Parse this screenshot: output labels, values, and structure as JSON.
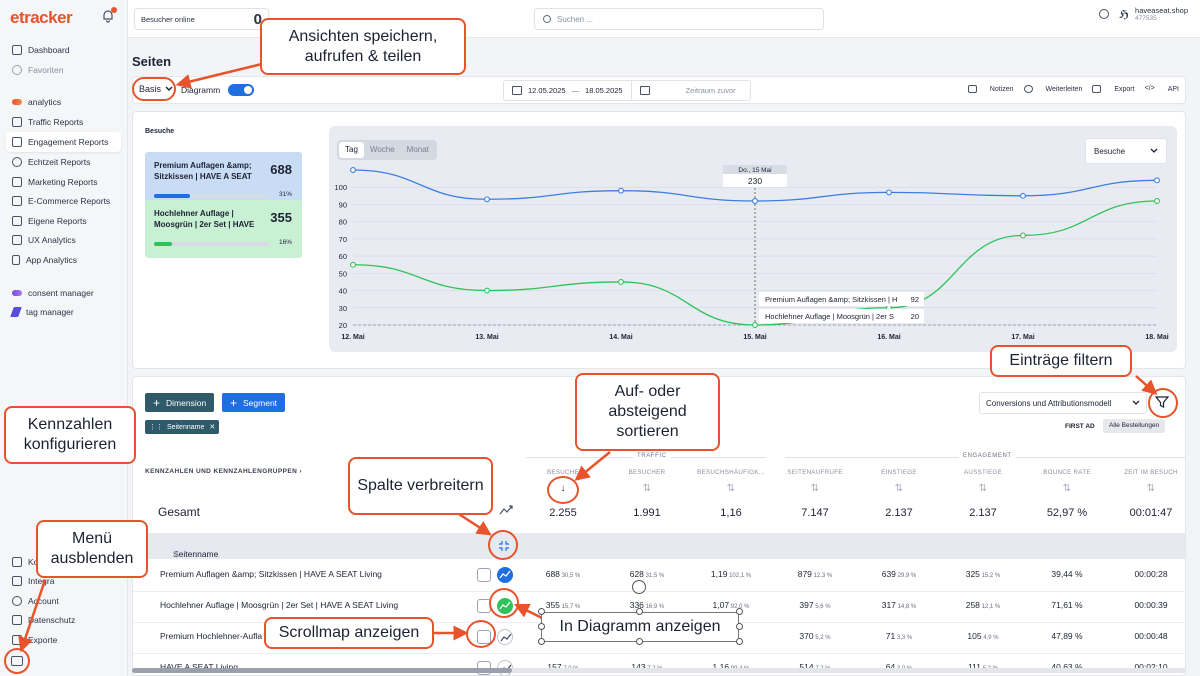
{
  "app": {
    "logo": "etracker"
  },
  "sidebar": {
    "items": [
      {
        "label": "Dashboard",
        "top": 44
      },
      {
        "label": "Favoriten",
        "muted": true
      },
      {
        "label": "analytics"
      },
      {
        "label": "Traffic Reports"
      },
      {
        "label": "Engagement Reports",
        "active": true
      },
      {
        "label": "Echtzeit Reports"
      },
      {
        "label": "Marketing Reports"
      },
      {
        "label": "E-Commerce Reports"
      },
      {
        "label": "Eigene Reports"
      },
      {
        "label": "UX Analytics"
      },
      {
        "label": "App Analytics"
      },
      {
        "label": "consent manager"
      },
      {
        "label": "tag manager"
      }
    ],
    "bottom": [
      "Ko",
      "Integra",
      "Account",
      "Datenschutz",
      "Exporte"
    ]
  },
  "topbar": {
    "visitors_label": "Besucher online",
    "visitors_count": "0",
    "search_placeholder": "Suchen ...",
    "account_name": "haveaseat.shop",
    "account_id": "477535"
  },
  "page": {
    "title": "Seiten"
  },
  "toolbar": {
    "view": "Basis",
    "diagram_label": "Diagramm",
    "date_from": "12.05.2025",
    "date_sep": "—",
    "date_to": "18.05.2025",
    "compare_placeholder": "Zeitraum zuvor",
    "actions": {
      "notes": "Notizen",
      "forward": "Weiterleiten",
      "export": "Export",
      "api": "API"
    }
  },
  "kpis": {
    "section_label": "Besuche",
    "cards": [
      {
        "name": "Premium Auflagen &amp; Sitzkissen | HAVE A SEAT",
        "value": "688",
        "pct": "31%",
        "share": 0.31
      },
      {
        "name": "Hochlehner Auflage | Moosgrün | 2er Set | HAVE",
        "value": "355",
        "pct": "16%",
        "share": 0.16
      }
    ]
  },
  "chart_controls": {
    "tabs": [
      "Tag",
      "Woche",
      "Monat"
    ],
    "active_tab": "Tag",
    "metric": "Besuche"
  },
  "chart_data": {
    "type": "line",
    "categories": [
      "12. Mai",
      "13. Mai",
      "14. Mai",
      "15. Mai",
      "16. Mai",
      "17. Mai",
      "18. Mai"
    ],
    "series": [
      {
        "name": "Premium Auflagen &amp; Sitzkissen | H",
        "color": "#3d7fe0",
        "values": [
          110,
          93,
          98,
          92,
          97,
          95,
          104
        ]
      },
      {
        "name": "Hochlehner Auflage | Moosgrün | 2er S",
        "color": "#2ec25a",
        "values": [
          55,
          40,
          45,
          20,
          30,
          72,
          92
        ]
      }
    ],
    "ylim": [
      20,
      110
    ],
    "yticks": [
      20,
      30,
      40,
      50,
      60,
      70,
      80,
      90,
      100
    ],
    "grid": true,
    "tooltip": {
      "date": "Do., 15 Mai",
      "total": "230",
      "rows": [
        {
          "label": "Premium Auflagen &amp; Sitzkissen | H",
          "value": "92"
        },
        {
          "label": "Hochlehner Auflage | Moosgrün | 2er S",
          "value": "20"
        }
      ]
    }
  },
  "table": {
    "btn_dimension": "Dimension",
    "btn_segment": "Segment",
    "chip": "Seitenname",
    "conversion_select": "Conversions und Attributionsmodell",
    "first_ad": "FIRST AD",
    "all_orders": "Alle Bestellungen",
    "kpi_header": "KENNZAHLEN UND KENNZAHLENGRUPPEN  ›",
    "group_traffic": "TRAFFIC",
    "group_engagement": "ENGAGEMENT",
    "columns": [
      "BESUCHE",
      "BESUCHER",
      "BESUCHSHÄUFIGK...",
      "SEITENAUFRUFE",
      "EINSTIEGE",
      "AUSSTIEGE",
      "BOUNCE RATE",
      "ZEIT IM BESUCH"
    ],
    "total_label": "Gesamt",
    "totals": [
      "2.255",
      "1.991",
      "1,16",
      "7.147",
      "2.137",
      "2.137",
      "52,97 %",
      "00:01:47"
    ],
    "dimension_header": "Seitenname",
    "rows": [
      {
        "name": "Premium Auflagen &amp; Sitzkissen | HAVE A SEAT Living",
        "cells": [
          [
            "688",
            "30,5 %"
          ],
          [
            "628",
            "31,5 %"
          ],
          [
            "1,19",
            "102,1 %"
          ],
          [
            "879",
            "12,3 %"
          ],
          [
            "639",
            "29,9 %"
          ],
          [
            "325",
            "15,2 %"
          ],
          [
            "39,44 %",
            ""
          ],
          [
            "00:00:28",
            ""
          ]
        ]
      },
      {
        "name": "Hochlehner Auflage | Moosgrün | 2er Set | HAVE A SEAT Living",
        "cells": [
          [
            "355",
            "15,7 %"
          ],
          [
            "336",
            "16,9 %"
          ],
          [
            "1,07",
            "92,0 %"
          ],
          [
            "397",
            "5,6 %"
          ],
          [
            "317",
            "14,8 %"
          ],
          [
            "258",
            "12,1 %"
          ],
          [
            "71,61 %",
            ""
          ],
          [
            "00:00:39",
            ""
          ]
        ]
      },
      {
        "name": "Premium Hochlehner-Aufla",
        "cells": [
          [
            "",
            ""
          ],
          [
            "",
            ""
          ],
          [
            "",
            "0 %"
          ],
          [
            "370",
            "5,2 %"
          ],
          [
            "71",
            "3,3 %"
          ],
          [
            "105",
            "4,9 %"
          ],
          [
            "47,89 %",
            ""
          ],
          [
            "00:00:48",
            ""
          ]
        ]
      },
      {
        "name": "HAVE A SEAT Living",
        "cells": [
          [
            "157",
            "7,0 %"
          ],
          [
            "143",
            "7,2 %"
          ],
          [
            "1,16",
            "99,4 %"
          ],
          [
            "514",
            "7,2 %"
          ],
          [
            "64",
            "3,0 %"
          ],
          [
            "111",
            "5,2 %"
          ],
          [
            "40,63 %",
            ""
          ],
          [
            "00:02:10",
            ""
          ]
        ]
      }
    ]
  },
  "annotations": {
    "save_views": "Ansichten speichern, aufrufen & teilen",
    "filter": "Einträge filtern",
    "sort": "Auf- oder absteigend sortieren",
    "configure": "Kennzahlen konfigurieren",
    "expand": "Spalte verbreitern",
    "hide_menu": "Menü ausblenden",
    "scrollmap": "Scrollmap anzeigen",
    "in_chart": "In Diagramm anzeigen"
  }
}
